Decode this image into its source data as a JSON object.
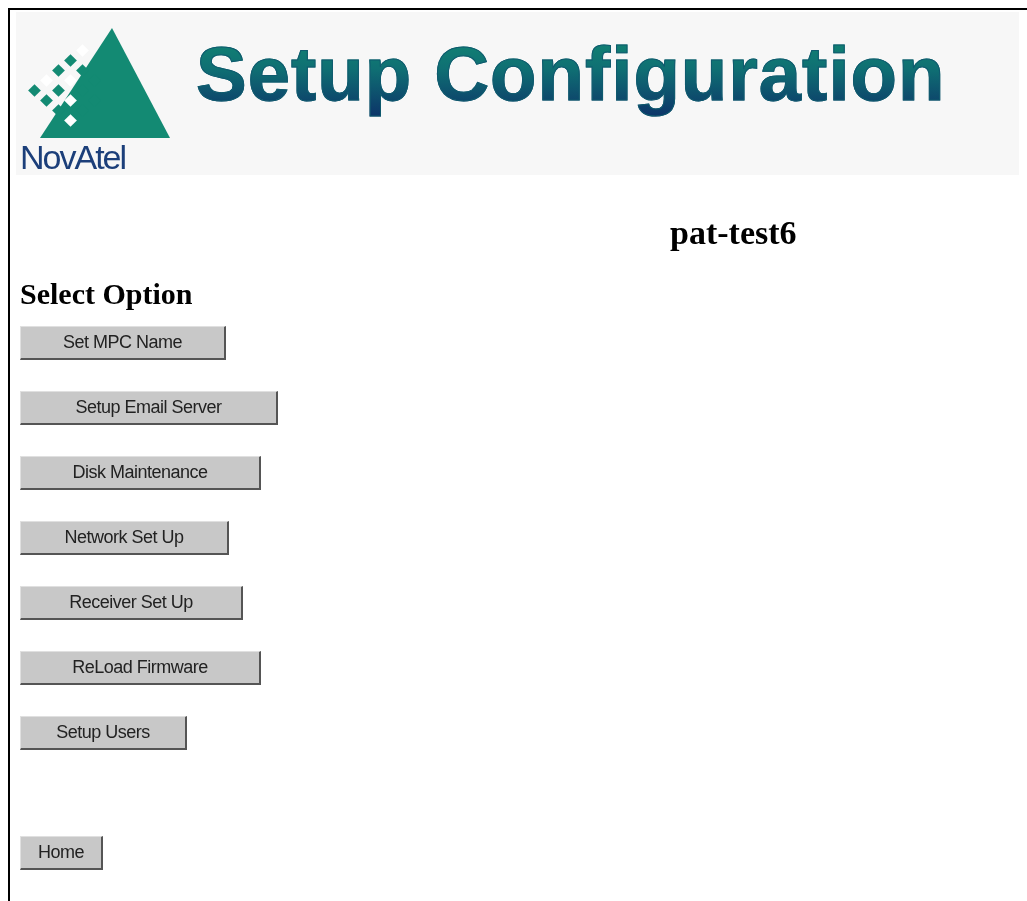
{
  "header": {
    "logo_text": "NovAtel",
    "title": "Setup Configuration"
  },
  "host_name": "pat-test6",
  "section_title": "Select Option",
  "options": [
    "Set MPC Name",
    "Setup Email Server",
    "Disk Maintenance",
    "Network Set Up",
    "Receiver Set Up",
    "ReLoad Firmware",
    "Setup Users"
  ],
  "home_button": "Home"
}
